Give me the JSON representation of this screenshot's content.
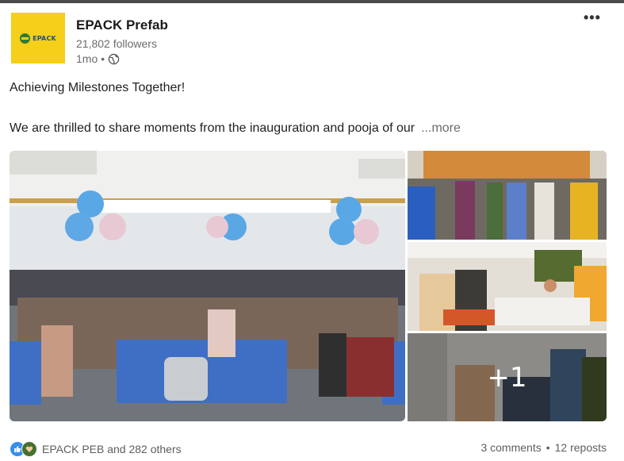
{
  "post": {
    "author": {
      "name": "EPACK Prefab",
      "followers": "21,802 followers",
      "time": "1mo",
      "separator": "•",
      "logo_text": "EPACK"
    },
    "menu_label": "•••",
    "headline": "Achieving Milestones Together!",
    "body": "We are thrilled to share moments from the inauguration and pooja of our",
    "more_label": "...more",
    "images": {
      "extra_count": "+1"
    },
    "reactions": {
      "summary": "EPACK PEB and 282 others"
    },
    "comments": "3 comments",
    "dot": "•",
    "reposts": "12 reposts"
  },
  "colors": {
    "logo_background": "#f5cf1a",
    "link_muted": "#6b6b6b",
    "like_blue": "#378fe9",
    "support_green": "#44712e"
  }
}
